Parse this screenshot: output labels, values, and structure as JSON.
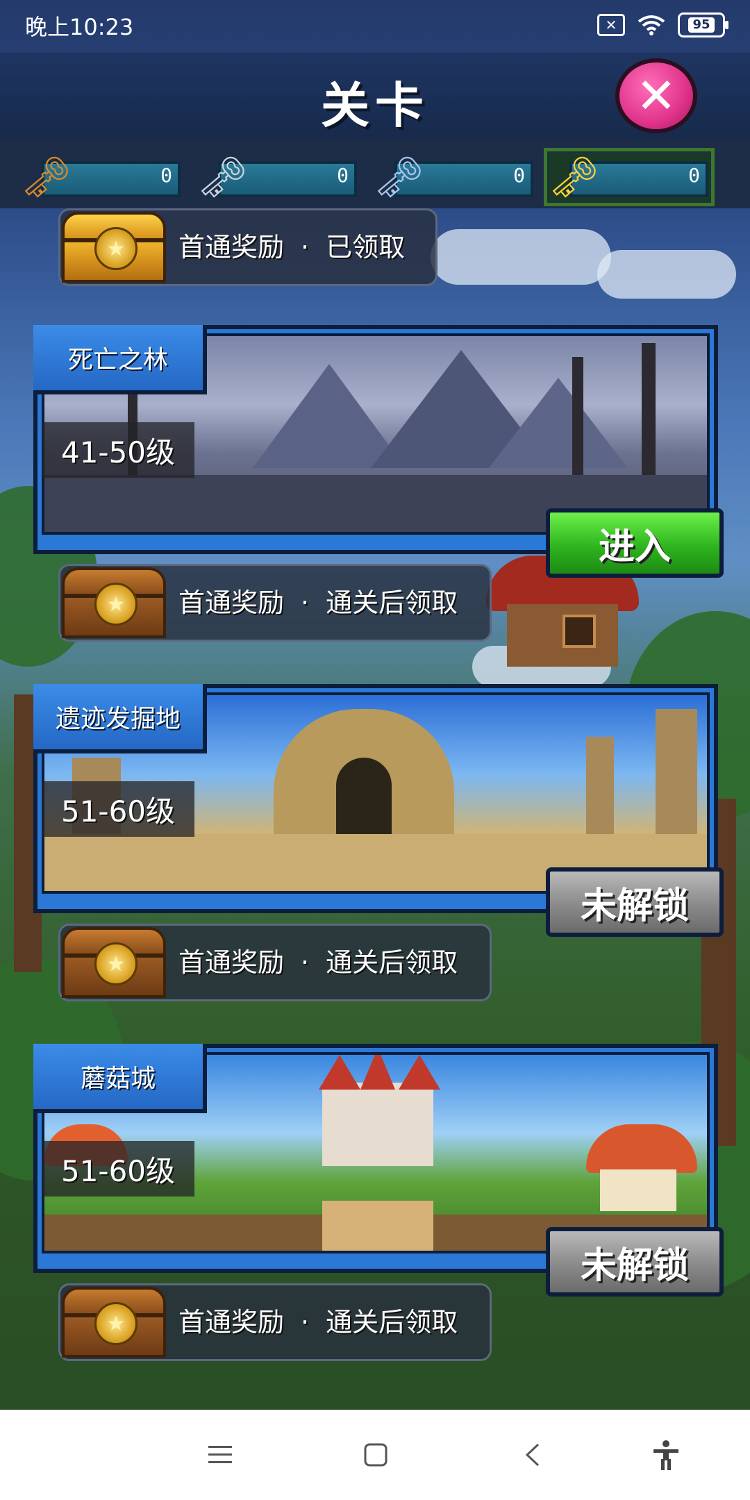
{
  "status_bar": {
    "time": "晚上10:23",
    "battery": "95",
    "icons": [
      "sim-off-icon",
      "wifi-icon",
      "battery-icon"
    ]
  },
  "header": {
    "title": "关卡",
    "close_icon": "close-icon"
  },
  "keys": [
    {
      "icon": "bronze-key-icon",
      "count": "0"
    },
    {
      "icon": "silver-key-icon",
      "count": "0"
    },
    {
      "icon": "ornate-key-icon",
      "count": "0"
    },
    {
      "icon": "gold-key-icon",
      "count": "0"
    }
  ],
  "top_reward": {
    "label": "首通奖励",
    "separator": "·",
    "status": "已领取"
  },
  "stages": [
    {
      "name": "死亡之林",
      "level": "41-50级",
      "action": "进入",
      "reward": {
        "label": "首通奖励",
        "separator": "·",
        "status": "通关后领取"
      }
    },
    {
      "name": "遗迹发掘地",
      "level": "51-60级",
      "action": "未解锁",
      "reward": {
        "label": "首通奖励",
        "separator": "·",
        "status": "通关后领取"
      }
    },
    {
      "name": "蘑菇城",
      "level": "51-60级",
      "action": "未解锁",
      "reward": {
        "label": "首通奖励",
        "separator": "·",
        "status": "通关后领取"
      }
    }
  ],
  "nav_bar": {
    "icons": [
      "menu-icon",
      "home-icon",
      "back-icon",
      "accessibility-icon"
    ]
  }
}
